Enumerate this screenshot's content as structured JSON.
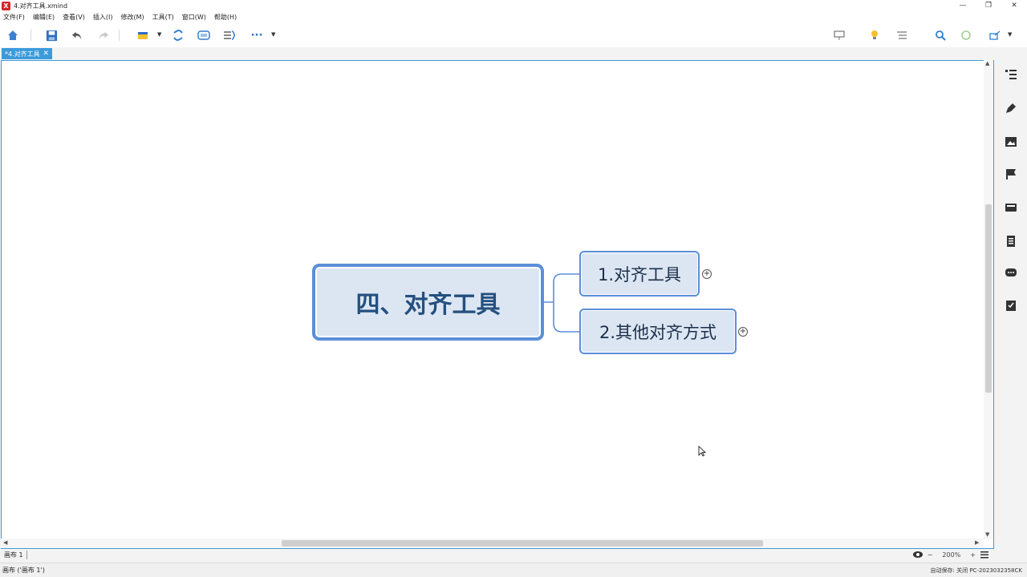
{
  "window": {
    "title": "4.对齐工具.xmind",
    "app_icon_letter": "X",
    "controls": {
      "minimize": "—",
      "restore": "❐",
      "close": "✕"
    }
  },
  "menu": [
    "文件(F)",
    "编辑(E)",
    "查看(V)",
    "插入(I)",
    "修改(M)",
    "工具(T)",
    "窗口(W)",
    "帮助(H)"
  ],
  "toolbar": {
    "more_label": "···",
    "icons": [
      "home-icon",
      "save-icon",
      "undo-icon",
      "redo-icon",
      "topic-icon",
      "relationship-icon",
      "boundary-icon",
      "summary-icon",
      "more-icon"
    ],
    "right_icons": [
      "presentation-icon",
      "brainstorm-icon",
      "outline-icon",
      "search-icon",
      "zoom-icon",
      "share-icon"
    ]
  },
  "tab": {
    "label": "*4.对齐工具",
    "close": "✕"
  },
  "mindmap": {
    "central": "四、对齐工具",
    "topics": [
      {
        "label": "1.对齐工具",
        "expand": "+"
      },
      {
        "label": "2.其他对齐方式",
        "expand": "+"
      }
    ]
  },
  "right_panel": [
    "outline-view-icon",
    "format-brush-icon",
    "image-icon",
    "flag-icon",
    "marker-icon",
    "notes-icon",
    "comment-icon",
    "task-icon"
  ],
  "sheetbar": {
    "sheet": "画布 1",
    "zoom": "200%",
    "zoom_out": "−",
    "zoom_in": "+"
  },
  "statusbar": {
    "left": "画布 ('画布 1')",
    "right": "自动保存: 关闭    PC-2023032358CK"
  },
  "colors": {
    "accent": "#3b9bdb",
    "node_fill": "#dce6f3",
    "node_border": "#5b8fd8",
    "central_text": "#24507f"
  }
}
